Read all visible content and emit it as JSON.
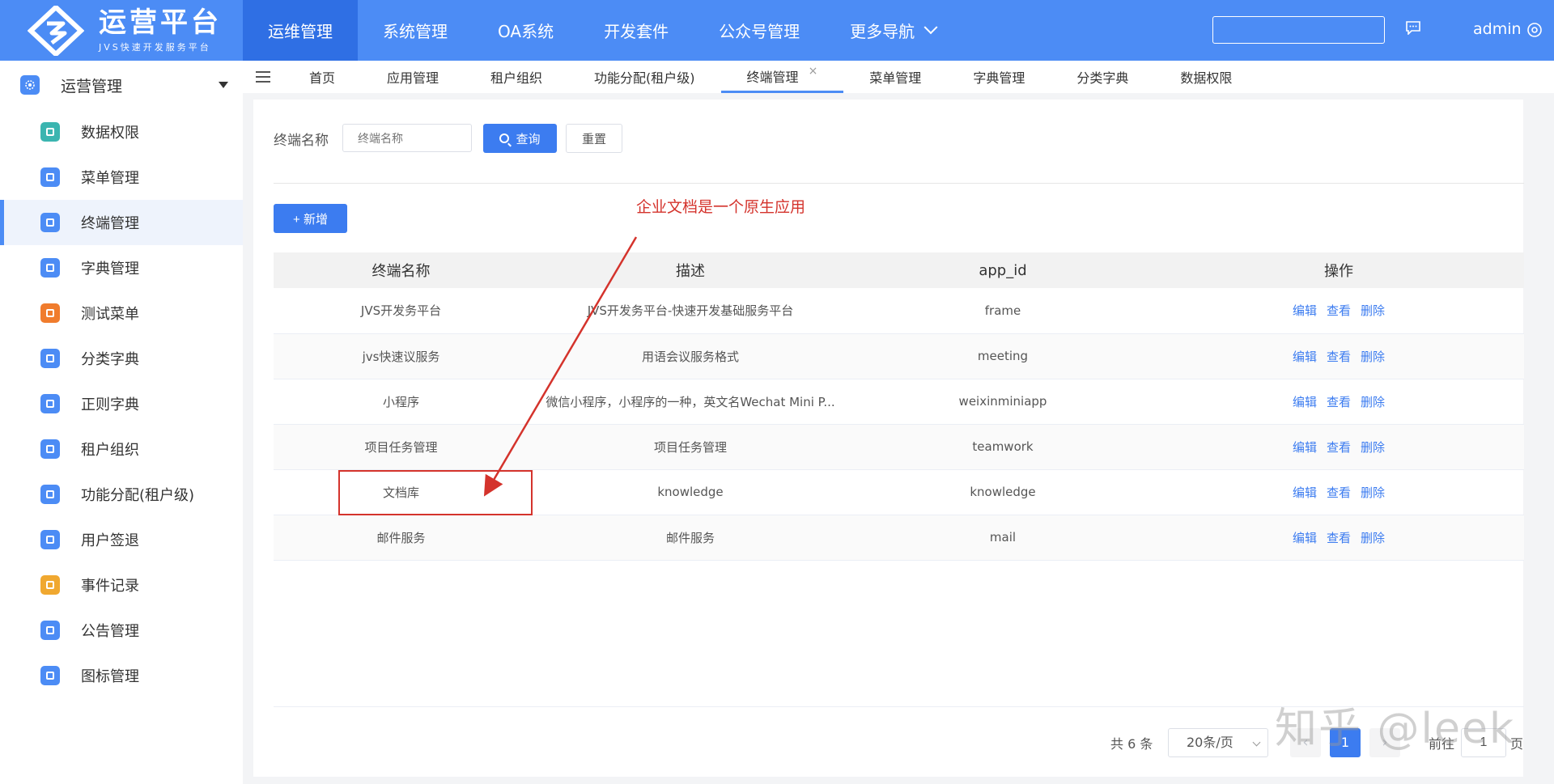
{
  "brand": {
    "title": "运营平台",
    "subtitle": "JVS快速开发服务平台"
  },
  "topnav": [
    {
      "label": "运维管理",
      "active": true
    },
    {
      "label": "系统管理"
    },
    {
      "label": "OA系统"
    },
    {
      "label": "开发套件"
    },
    {
      "label": "公众号管理"
    },
    {
      "label": "更多导航"
    }
  ],
  "header": {
    "search_placeholder": "",
    "user": "admin"
  },
  "sidebar": {
    "group": "运营管理",
    "items": [
      {
        "label": "数据权限",
        "color": "#3bb5b0",
        "icon": "shield-data-icon"
      },
      {
        "label": "菜单管理",
        "color": "#4c8cf5",
        "icon": "menu-icon"
      },
      {
        "label": "终端管理",
        "color": "#4c8cf5",
        "icon": "terminal-icon",
        "active": true
      },
      {
        "label": "字典管理",
        "color": "#4c8cf5",
        "icon": "home-icon"
      },
      {
        "label": "测试菜单",
        "color": "#f07c2d",
        "icon": "home-icon"
      },
      {
        "label": "分类字典",
        "color": "#4c8cf5",
        "icon": "bar-chart-icon"
      },
      {
        "label": "正则字典",
        "color": "#4c8cf5",
        "icon": "globe-icon"
      },
      {
        "label": "租户组织",
        "color": "#4c8cf5",
        "icon": "org-icon"
      },
      {
        "label": "功能分配(租户级)",
        "color": "#4c8cf5",
        "icon": "box-icon"
      },
      {
        "label": "用户签退",
        "color": "#4c8cf5",
        "icon": "logout-icon"
      },
      {
        "label": "事件记录",
        "color": "#f0a830",
        "icon": "list-icon"
      },
      {
        "label": "公告管理",
        "color": "#4c8cf5",
        "icon": "chart-icon"
      },
      {
        "label": "图标管理",
        "color": "#4c8cf5",
        "icon": "box-icon"
      }
    ]
  },
  "tabs": [
    {
      "label": "首页"
    },
    {
      "label": "应用管理"
    },
    {
      "label": "租户组织"
    },
    {
      "label": "功能分配(租户级)"
    },
    {
      "label": "终端管理",
      "active": true,
      "close": "×"
    },
    {
      "label": "菜单管理"
    },
    {
      "label": "字典管理"
    },
    {
      "label": "分类字典"
    },
    {
      "label": "数据权限"
    }
  ],
  "filter": {
    "label": "终端名称",
    "placeholder": "终端名称",
    "query_label": "查询",
    "reset_label": "重置"
  },
  "add_label": "+ 新增",
  "annotation": "企业文档是一个原生应用",
  "table": {
    "columns": [
      "终端名称",
      "描述",
      "app_id",
      "操作"
    ],
    "rows": [
      {
        "name": "JVS开发务平台",
        "desc": "JVS开发务平台-快速开发基础服务平台",
        "app_id": "frame"
      },
      {
        "name": "jvs快速议服务",
        "desc": "用语会议服务格式",
        "app_id": "meeting"
      },
      {
        "name": "小程序",
        "desc": "微信小程序，小程序的一种，英文名Wechat Mini P...",
        "app_id": "weixinminiapp"
      },
      {
        "name": "项目任务管理",
        "desc": "项目任务管理",
        "app_id": "teamwork"
      },
      {
        "name": "文档库",
        "desc": "knowledge",
        "app_id": "knowledge"
      },
      {
        "name": "邮件服务",
        "desc": "邮件服务",
        "app_id": "mail"
      }
    ],
    "actions": [
      "编辑",
      "查看",
      "删除"
    ]
  },
  "pagination": {
    "total": "共 6 条",
    "page_size": "20条/页",
    "current": "1",
    "goto_label": "前往",
    "goto_value": "1",
    "goto_unit": "页"
  },
  "watermark": "知乎 @leek"
}
